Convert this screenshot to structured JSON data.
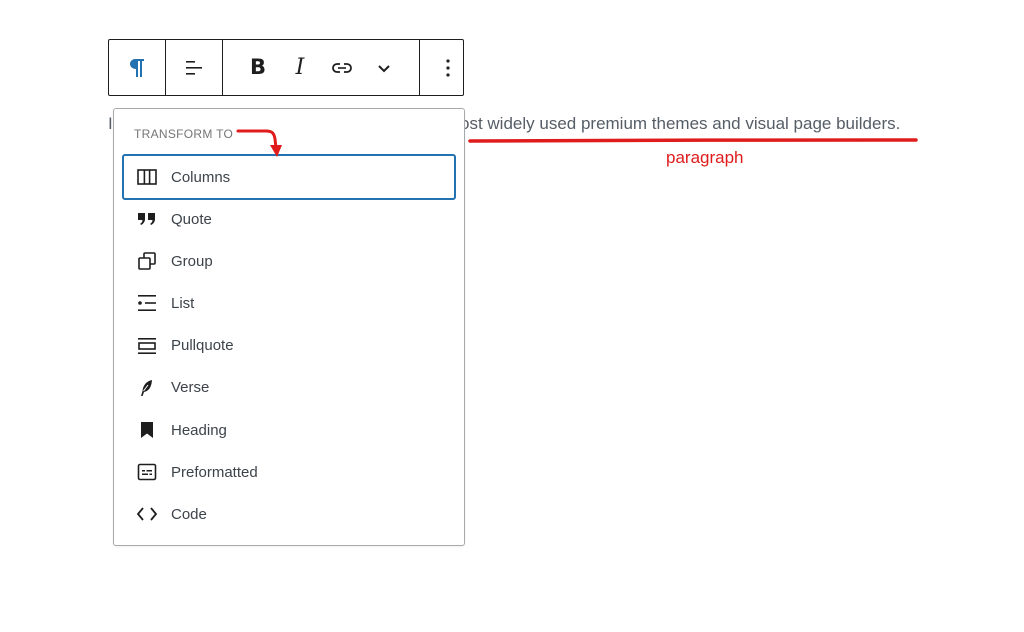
{
  "toolbar": {
    "paragraph_icon": "paragraph-icon",
    "align_icon": "align-left-icon",
    "bold_label": "B",
    "italic_label": "I",
    "link_icon": "link-icon",
    "more_icon": "chevron-down-icon",
    "options_icon": "vertical-ellipsis-icon"
  },
  "paragraph": {
    "leading_visible": "I",
    "trailing_visible": "ost widely used premium themes and visual page builders."
  },
  "dropdown": {
    "heading": "TRANSFORM TO",
    "items": [
      {
        "label": "Columns",
        "icon": "columns-icon"
      },
      {
        "label": "Quote",
        "icon": "quote-icon"
      },
      {
        "label": "Group",
        "icon": "group-icon"
      },
      {
        "label": "List",
        "icon": "list-icon"
      },
      {
        "label": "Pullquote",
        "icon": "pullquote-icon"
      },
      {
        "label": "Verse",
        "icon": "verse-icon"
      },
      {
        "label": "Heading",
        "icon": "heading-icon"
      },
      {
        "label": "Preformatted",
        "icon": "preformatted-icon"
      },
      {
        "label": "Code",
        "icon": "code-icon"
      }
    ]
  },
  "annotation": {
    "label": "paragraph",
    "color": "#e01b1b"
  },
  "colors": {
    "accent": "#2271b1",
    "paragraph_icon": "#2271b1"
  }
}
